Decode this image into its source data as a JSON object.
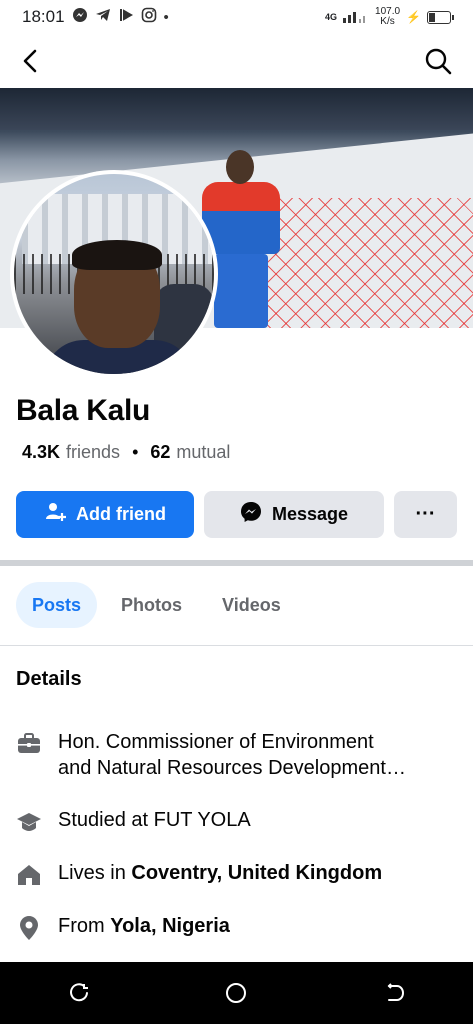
{
  "status_bar": {
    "time": "18:01",
    "network_type": "4G",
    "speed_value": "107.0",
    "speed_unit": "K/s"
  },
  "profile": {
    "name": "Bala Kalu",
    "friends_count": "4.3K",
    "friends_label": "friends",
    "mutual_count": "62",
    "mutual_label": "mutual"
  },
  "actions": {
    "add_friend": "Add friend",
    "message": "Message",
    "more": "···"
  },
  "tabs": [
    {
      "label": "Posts",
      "active": true
    },
    {
      "label": "Photos",
      "active": false
    },
    {
      "label": "Videos",
      "active": false
    }
  ],
  "details": {
    "title": "Details",
    "work_line1": "Hon. Commissioner of Environment",
    "work_line2": "and Natural Resources Development…",
    "education": "Studied at FUT YOLA",
    "lives_prefix": "Lives in ",
    "lives_place": "Coventry, United Kingdom",
    "from_prefix": "From ",
    "from_place": "Yola, Nigeria"
  },
  "colors": {
    "accent": "#1877f2",
    "secondary_button": "#e4e6eb",
    "active_tab_bg": "#e7f3ff",
    "muted_text": "#65676b",
    "icon_gray": "#65676b"
  },
  "icons": {
    "back": "back-arrow-icon",
    "search": "search-icon",
    "add_friend": "add-friend-icon",
    "message": "messenger-icon",
    "work": "briefcase-icon",
    "education": "graduation-cap-icon",
    "home": "home-icon",
    "location": "location-pin-icon"
  }
}
